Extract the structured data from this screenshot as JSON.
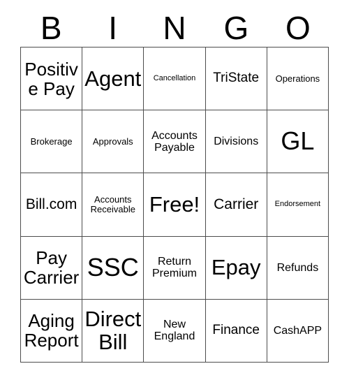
{
  "card": {
    "header_letters": [
      "B",
      "I",
      "N",
      "G",
      "O"
    ],
    "columns": 5,
    "rows": 5,
    "text_color": "#000000",
    "border_color": "#4d4d4d",
    "cell_background": "#ffffff",
    "free_space": "Free!",
    "cells": [
      [
        {
          "label": "Positive Pay",
          "size": "lg"
        },
        {
          "label": "Agent",
          "size": "xl"
        },
        {
          "label": "Cancellation",
          "size": "tiny"
        },
        {
          "label": "TriState",
          "size": "sm"
        },
        {
          "label": "Operations",
          "size": "xxs"
        }
      ],
      [
        {
          "label": "Brokerage",
          "size": "xxs"
        },
        {
          "label": "Approvals",
          "size": "xxs"
        },
        {
          "label": "Accounts Payable",
          "size": "xs"
        },
        {
          "label": "Divisions",
          "size": "xs"
        },
        {
          "label": "GL",
          "size": "xxl"
        }
      ],
      [
        {
          "label": "Bill.com",
          "size": "md"
        },
        {
          "label": "Accounts Receivable",
          "size": "xxs"
        },
        {
          "label": "Free!",
          "size": "xl"
        },
        {
          "label": "Carrier",
          "size": "md"
        },
        {
          "label": "Endorsement",
          "size": "tiny"
        }
      ],
      [
        {
          "label": "Pay Carrier",
          "size": "lg"
        },
        {
          "label": "SSC",
          "size": "xxl"
        },
        {
          "label": "Return Premium",
          "size": "xs"
        },
        {
          "label": "Epay",
          "size": "xl"
        },
        {
          "label": "Refunds",
          "size": "xs"
        }
      ],
      [
        {
          "label": "Aging Report",
          "size": "lg"
        },
        {
          "label": "Direct Bill",
          "size": "xl"
        },
        {
          "label": "New England",
          "size": "xs"
        },
        {
          "label": "Finance",
          "size": "sm"
        },
        {
          "label": "CashAPP",
          "size": "xs"
        }
      ]
    ]
  }
}
